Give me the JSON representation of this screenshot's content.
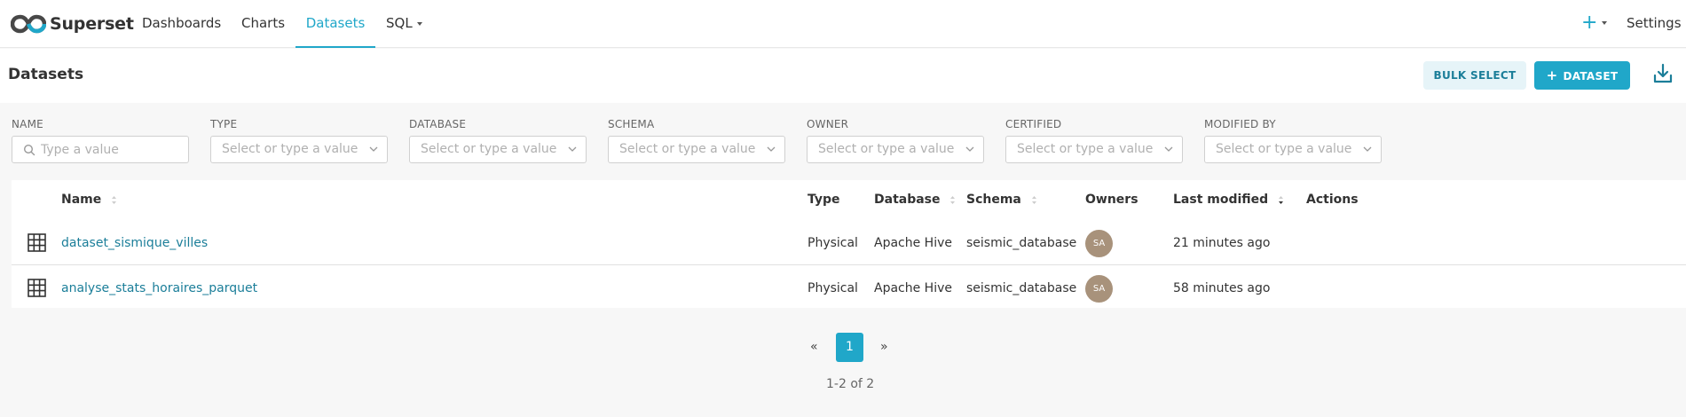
{
  "brand": {
    "name": "Superset",
    "accent": "#20a7c9"
  },
  "nav": {
    "dashboards": "Dashboards",
    "charts": "Charts",
    "datasets": "Datasets",
    "sql": "SQL",
    "plus": "+",
    "settings": "Settings"
  },
  "header": {
    "title": "Datasets",
    "bulk_select": "BULK SELECT",
    "add_dataset": "DATASET"
  },
  "filters": {
    "name": {
      "label": "NAME",
      "placeholder": "Type a value"
    },
    "type": {
      "label": "TYPE",
      "placeholder": "Select or type a value"
    },
    "database": {
      "label": "DATABASE",
      "placeholder": "Select or type a value"
    },
    "schema": {
      "label": "SCHEMA",
      "placeholder": "Select or type a value"
    },
    "owner": {
      "label": "OWNER",
      "placeholder": "Select or type a value"
    },
    "certified": {
      "label": "CERTIFIED",
      "placeholder": "Select or type a value"
    },
    "modified_by": {
      "label": "MODIFIED BY",
      "placeholder": "Select or type a value"
    }
  },
  "table": {
    "columns": {
      "name": "Name",
      "type": "Type",
      "database": "Database",
      "schema": "Schema",
      "owners": "Owners",
      "last_modified": "Last modified",
      "actions": "Actions"
    },
    "rows": [
      {
        "name": "dataset_sismique_villes",
        "type": "Physical",
        "database": "Apache Hive",
        "schema": "seismic_database",
        "owner_initials": "SA",
        "modified": "21 minutes ago"
      },
      {
        "name": "analyse_stats_horaires_parquet",
        "type": "Physical",
        "database": "Apache Hive",
        "schema": "seismic_database",
        "owner_initials": "SA",
        "modified": "58 minutes ago"
      }
    ]
  },
  "pagination": {
    "prev": "«",
    "current": "1",
    "next": "»",
    "count": "1-2 of 2"
  }
}
